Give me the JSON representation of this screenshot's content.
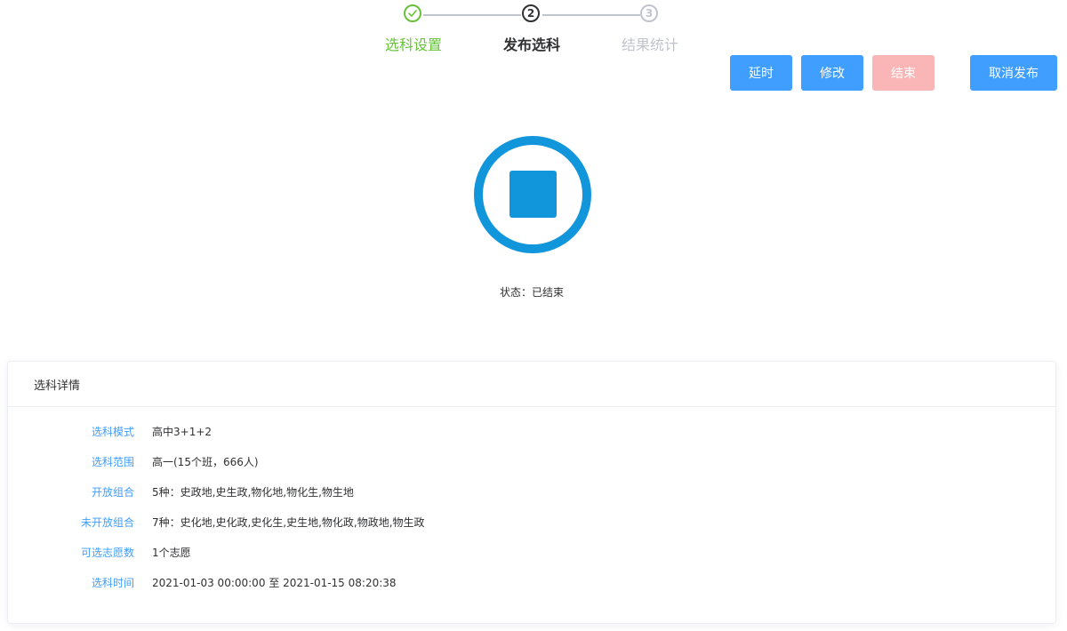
{
  "steps": [
    {
      "number": "1",
      "title": "选科设置",
      "state": "done"
    },
    {
      "number": "2",
      "title": "发布选科",
      "state": "active"
    },
    {
      "number": "3",
      "title": "结果统计",
      "state": "wait"
    }
  ],
  "actions": {
    "extend": "延时",
    "modify": "修改",
    "end": "结束",
    "cancel_publish": "取消发布"
  },
  "status": {
    "icon": "stop-icon",
    "text": "状态：已结束"
  },
  "detail": {
    "title": "选科详情",
    "rows": [
      {
        "label": "选科模式",
        "value": "高中3+1+2"
      },
      {
        "label": "选科范围",
        "value": "高一(15个班，666人)"
      },
      {
        "label": "开放组合",
        "value": "5种：史政地,史生政,物化地,物化生,物生地"
      },
      {
        "label": "未开放组合",
        "value": "7种：史化地,史化政,史化生,史生地,物化政,物政地,物生政"
      },
      {
        "label": "可选志愿数",
        "value": "1个志愿"
      },
      {
        "label": "选科时间",
        "value": "2021-01-03 00:00:00 至 2021-01-15 08:20:38"
      }
    ]
  },
  "colors": {
    "success": "#67c23a",
    "primary": "#409eff",
    "danger_disabled": "#fab6b6",
    "status_icon": "#1296db"
  }
}
